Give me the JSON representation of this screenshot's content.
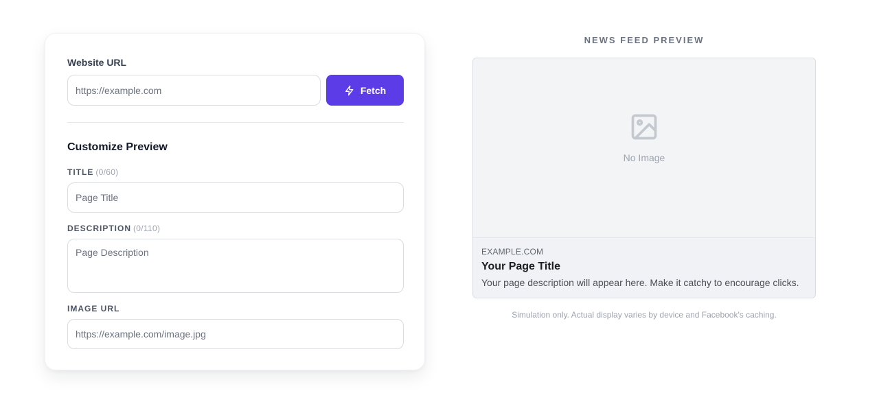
{
  "form": {
    "website_url_label": "Website URL",
    "url_placeholder": "https://example.com",
    "fetch_label": "Fetch",
    "section_title": "Customize Preview",
    "title_label": "Title",
    "title_counter": "(0/60)",
    "title_placeholder": "Page Title",
    "description_label": "Description",
    "description_counter": "(0/110)",
    "description_placeholder": "Page Description",
    "image_label": "Image URL",
    "image_placeholder": "https://example.com/image.jpg"
  },
  "preview": {
    "heading": "NEWS FEED PREVIEW",
    "no_image": "No Image",
    "domain": "EXAMPLE.COM",
    "title": "Your Page Title",
    "description": "Your page description will appear here. Make it catchy to encourage clicks.",
    "disclaimer": "Simulation only. Actual display varies by device and Facebook's caching."
  },
  "icons": {
    "fetch": "lightning-bolt-icon",
    "placeholder": "image-icon"
  },
  "colors": {
    "accent": "#5b3ce6",
    "placeholder_bg": "#f3f4f6"
  }
}
